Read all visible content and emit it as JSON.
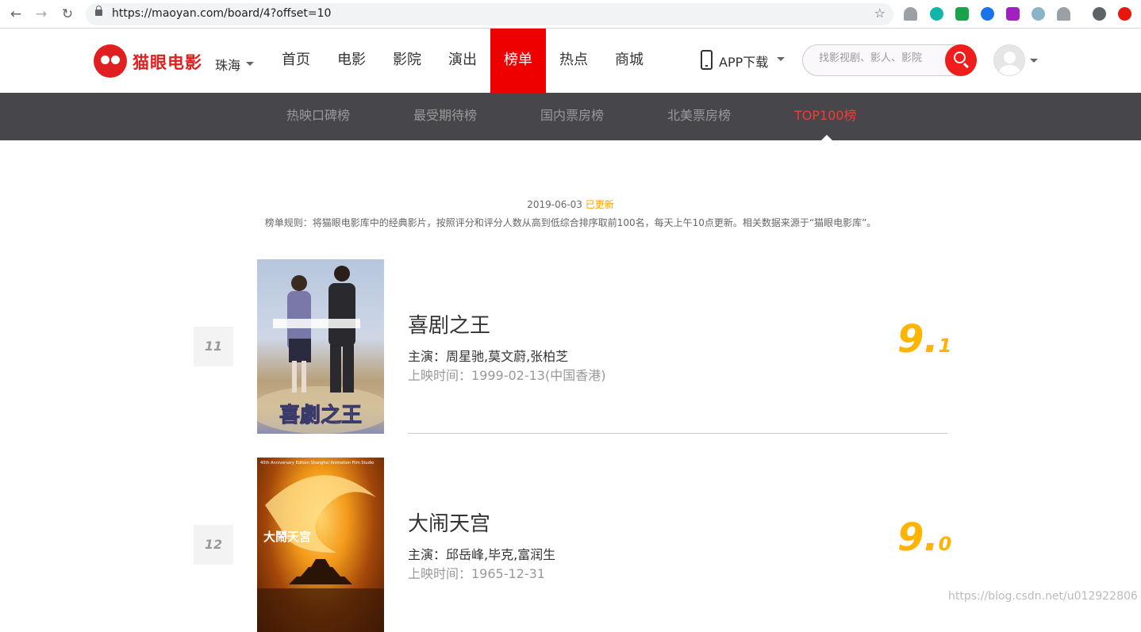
{
  "browser": {
    "url": "https://maoyan.com/board/4?offset=10"
  },
  "header": {
    "logo_text": "猫眼电影",
    "city": "珠海",
    "nav": [
      {
        "label": "首页",
        "active": false
      },
      {
        "label": "电影",
        "active": false
      },
      {
        "label": "影院",
        "active": false
      },
      {
        "label": "演出",
        "active": false
      },
      {
        "label": "榜单",
        "active": true
      },
      {
        "label": "热点",
        "active": false
      },
      {
        "label": "商城",
        "active": false
      }
    ],
    "app_download": "APP下载",
    "search_placeholder": "找影视剧、影人、影院"
  },
  "subnav": [
    {
      "label": "热映口碑榜",
      "active": false
    },
    {
      "label": "最受期待榜",
      "active": false
    },
    {
      "label": "国内票房榜",
      "active": false
    },
    {
      "label": "北美票房榜",
      "active": false
    },
    {
      "label": "TOP100榜",
      "active": true
    }
  ],
  "board": {
    "date": "2019-06-03",
    "updated_label": "已更新",
    "rule": "榜单规则：将猫眼电影库中的经典影片，按照评分和评分人数从高到低综合排序取前100名，每天上午10点更新。相关数据来源于“猫眼电影库”。"
  },
  "movies": [
    {
      "rank": "11",
      "title": "喜剧之王",
      "stars": "主演：周星驰,莫文蔚,张柏芝",
      "release": "上映时间：1999-02-13(中国香港)",
      "score_int": "9.",
      "score_frac": "1"
    },
    {
      "rank": "12",
      "title": "大闹天宫",
      "stars": "主演：邱岳峰,毕克,富润生",
      "release": "上映时间：1965-12-31",
      "score_int": "9.",
      "score_frac": "0"
    }
  ],
  "watermark": "https://blog.csdn.net/u012922806",
  "colors": {
    "brand_red": "#ef0000",
    "subnav_bg": "#47464a",
    "score_gold": "#ffb400",
    "update_orange": "#fba000"
  }
}
